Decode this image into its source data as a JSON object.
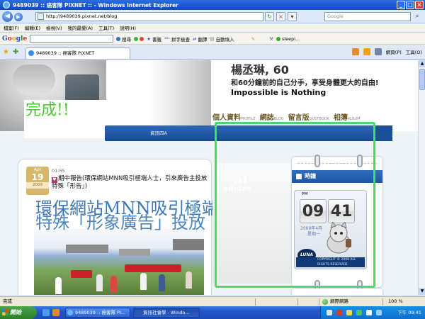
{
  "window": {
    "title": "9489039 :: 癌客隊 PIXNET :: - Windows Internet Explorer",
    "controls": [
      "_",
      "□",
      "×"
    ]
  },
  "address_bar": {
    "url": "http://9489039.pixnet.net/blog",
    "search_placeholder": "Google"
  },
  "menu": [
    "檔案(F)",
    "編輯(E)",
    "檢視(V)",
    "我的最愛(A)",
    "工具(T)",
    "說明(H)"
  ],
  "google_toolbar": {
    "logo": "Google",
    "search_label": "搜尋",
    "bookmarks_label": "書籤",
    "spellcheck_label": "拼字檢查",
    "translate_label": "翻譯",
    "autofill_label": "自動填入",
    "user_label": "sleepi..."
  },
  "tabs": [
    {
      "label": "9489039 :: 癌客隊 PIXNET"
    }
  ],
  "command_bar": {
    "page_label": "網頁(P)",
    "tools_label": "工具(O)"
  },
  "page": {
    "header": {
      "name": "楊丞琳, 60",
      "slogan": "和60分鐘前的自己分手，享受身體更大的自由!",
      "tagline": "Impossible is Nothing",
      "done_label": "完成!!",
      "nav": [
        {
          "cn": "個人資料",
          "en": "PROFILE"
        },
        {
          "cn": "網誌",
          "en": "BLOG"
        },
        {
          "cn": "留言版",
          "en": "GUSTBOOK"
        },
        {
          "cn": "相簿",
          "en": "ALBUM"
        }
      ]
    },
    "topbar_text": "資訊四A",
    "post": {
      "date_month": "Apr",
      "date_day": "19",
      "date_year": "2009",
      "time": "01:55",
      "excerpt": "期中報告(環保網站MNN吸引極端人士，引來廣告主投放特殊「形告」)",
      "overlay_line1": "環保網站MNN吸引極端",
      "overlay_line2": "特殊「形象廣告」投放"
    },
    "ad_text": "adidas",
    "sidebar": {
      "heading": "時鐘",
      "clock": {
        "period": "PM",
        "hour": "09",
        "minute": "41",
        "date": "2009年4月",
        "weekday": "星期一",
        "brand": "LUNA",
        "footer": "COPYRIGHT © 2008 ALL RIGHTS RESERVED."
      }
    }
  },
  "status_bar": {
    "left": "完成",
    "zone": "網際網路",
    "zoom": "100 %"
  },
  "taskbar": {
    "start_label": "開始",
    "tasks": [
      {
        "label": "9489039 :: 癌客隊 PI..."
      },
      {
        "label": "資訊社會學 - Windo..."
      }
    ],
    "clock": "下午 09:41"
  },
  "colors": {
    "highlight_box": "#4fd86a",
    "done_text": "#4cc832",
    "blog_blue": "#1e55a3"
  }
}
